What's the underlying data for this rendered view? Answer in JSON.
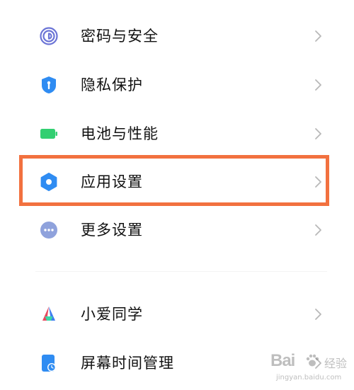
{
  "settings_list": {
    "items": [
      {
        "label": "密码与安全",
        "icon": "fingerprint-icon",
        "color": "#6b74d6"
      },
      {
        "label": "隐私保护",
        "icon": "shield-icon",
        "color": "#2f8cf2"
      },
      {
        "label": "电池与性能",
        "icon": "battery-icon",
        "color": "#32cf71"
      },
      {
        "label": "应用设置",
        "icon": "gear-icon",
        "color": "#2f8cf2"
      },
      {
        "label": "更多设置",
        "icon": "more-dots-icon",
        "color": "#8fa2dc"
      },
      {
        "label": "小爱同学",
        "icon": "xiaoai-icon",
        "colors": [
          "#e8495f",
          "#3f7ef0",
          "#3ad8a8"
        ]
      },
      {
        "label": "屏幕时间管理",
        "icon": "screen-time-icon",
        "color": "#2f8cf2"
      }
    ],
    "highlighted_item": "应用设置",
    "highlight_color": "#f2713f",
    "chevron": "chevron-right-icon"
  },
  "watermark": {
    "brand": "Bai",
    "brand_suffix": "经验",
    "url": "jingyan.baidu.com"
  }
}
